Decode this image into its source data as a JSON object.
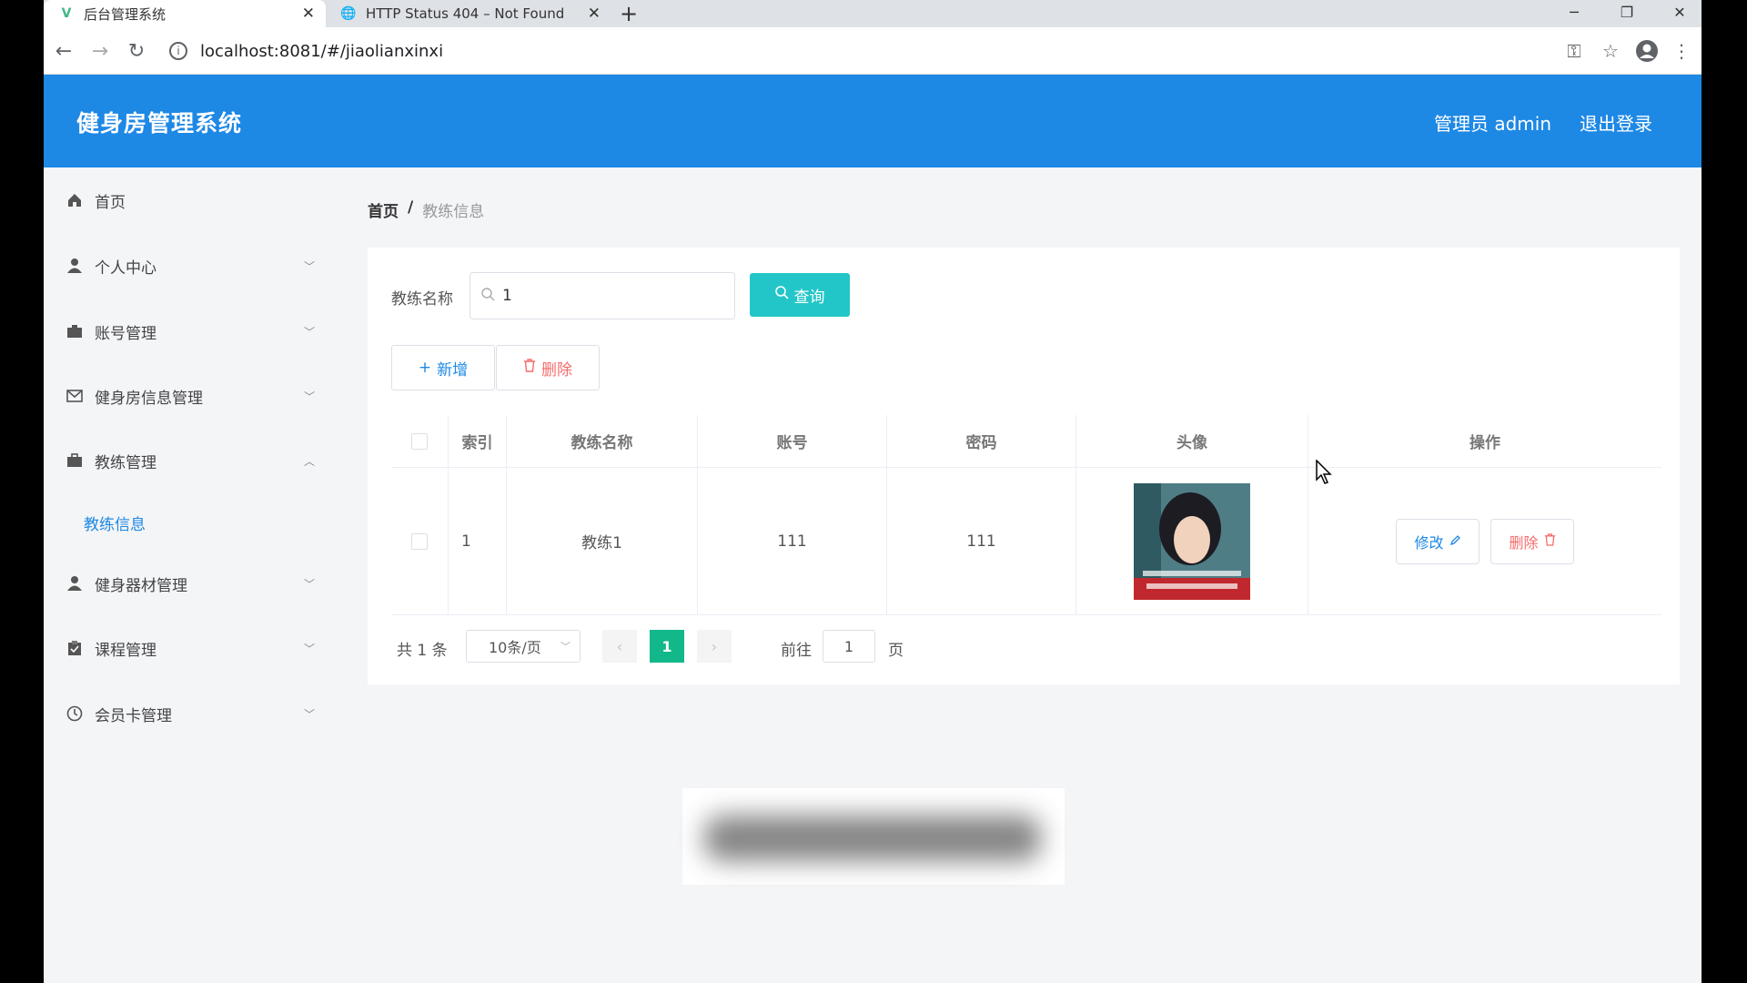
{
  "browser": {
    "tabs": [
      {
        "title": "后台管理系统",
        "active": true,
        "icon": "vue-logo-icon"
      },
      {
        "title": "HTTP Status 404 – Not Found",
        "active": false,
        "icon": "globe-icon"
      }
    ],
    "url": "localhost:8081/#/jiaolianxinxi"
  },
  "header": {
    "title": "健身房管理系统",
    "user": "管理员 admin",
    "logout": "退出登录",
    "color": "#1e88e5"
  },
  "sidebar": {
    "items": [
      {
        "label": "首页",
        "icon": "home-icon"
      },
      {
        "label": "个人中心",
        "icon": "user-icon"
      },
      {
        "label": "账号管理",
        "icon": "account-icon"
      },
      {
        "label": "健身房信息管理",
        "icon": "mail-icon"
      },
      {
        "label": "教练管理",
        "icon": "briefcase-icon",
        "expanded": true
      },
      {
        "label": "健身器材管理",
        "icon": "user-icon"
      },
      {
        "label": "课程管理",
        "icon": "clipboard-icon"
      },
      {
        "label": "会员卡管理",
        "icon": "clock-icon"
      }
    ],
    "submenu": {
      "label": "教练信息"
    }
  },
  "breadcrumb": {
    "home": "首页",
    "separator": "/",
    "current": "教练信息"
  },
  "search": {
    "label": "教练名称",
    "value": "1",
    "button": "查询"
  },
  "actions": {
    "add": "新增",
    "delete": "删除"
  },
  "table": {
    "headers": [
      "索引",
      "教练名称",
      "账号",
      "密码",
      "头像",
      "操作"
    ],
    "rows": [
      {
        "index": "1",
        "name": "教练1",
        "account": "111",
        "password": "111",
        "edit": "修改",
        "delete": "删除"
      }
    ]
  },
  "pagination": {
    "total": "共 1 条",
    "page_size": "10条/页",
    "current": "1",
    "goto_label": "前往",
    "goto_value": "1",
    "page_label": "页"
  },
  "colors": {
    "accent": "#1e88e5",
    "query": "#23c6c8",
    "danger": "#f56c6c",
    "current_page": "#13b88a"
  }
}
